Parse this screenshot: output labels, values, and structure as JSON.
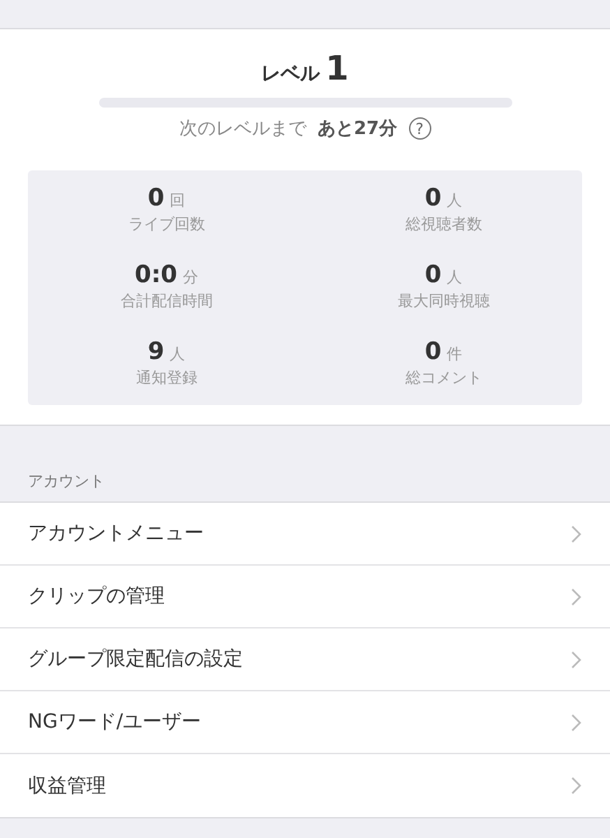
{
  "level": {
    "label": "レベル",
    "value": "1",
    "level": 0,
    "next_text": "次のレベルまで",
    "remaining": "あと27分",
    "help_icon": "?"
  },
  "stats": [
    {
      "value": "0",
      "unit": "回",
      "label": "ライブ回数"
    },
    {
      "value": "0",
      "unit": "人",
      "label": "総視聴者数"
    },
    {
      "value": "0:0",
      "unit": "分",
      "label": "合計配信時間"
    },
    {
      "value": "0",
      "unit": "人",
      "label": "最大同時視聴"
    },
    {
      "value": "9",
      "unit": "人",
      "label": "通知登録"
    },
    {
      "value": "0",
      "unit": "件",
      "label": "総コメント"
    }
  ],
  "account": {
    "heading": "アカウント",
    "items": [
      {
        "label": "アカウントメニュー"
      },
      {
        "label": "クリップの管理"
      },
      {
        "label": "グループ限定配信の設定"
      },
      {
        "label": "NGワード/ユーザー"
      },
      {
        "label": "収益管理"
      }
    ]
  }
}
